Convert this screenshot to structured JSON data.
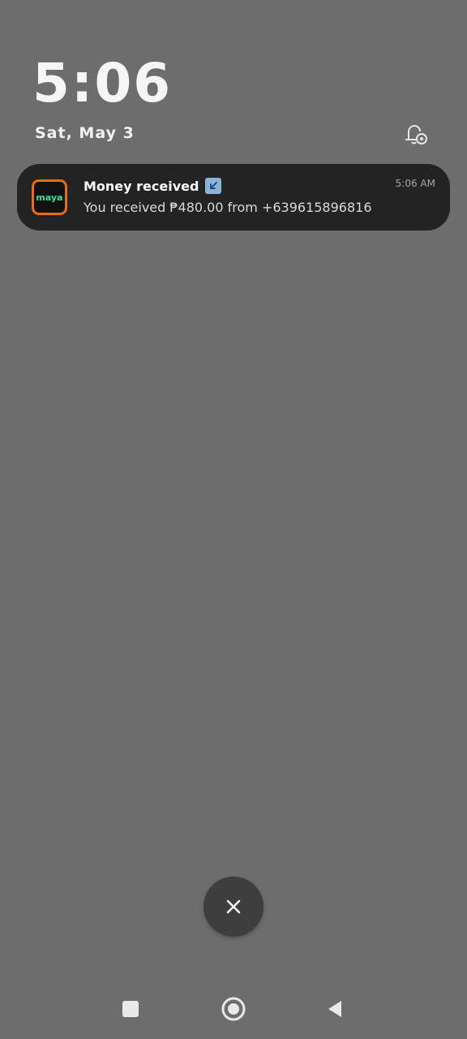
{
  "lockscreen": {
    "time": "5:06",
    "date": "Sat, May 3"
  },
  "notification": {
    "app": "maya",
    "title": "Money received",
    "time": "5:06 AM",
    "body": "You received ₱480.00 from +639615896816"
  },
  "icons": {
    "notification_settings": "bell-gear-icon",
    "dismiss": "close-icon",
    "nav_recents": "square-icon",
    "nav_home": "circle-icon",
    "nav_back": "triangle-back-icon",
    "title_badge": "arrow-down-left-icon"
  },
  "colors": {
    "background": "#6d6d6d",
    "card": "#232323",
    "maya_orange": "#e76d10",
    "maya_green": "#36e28f"
  }
}
